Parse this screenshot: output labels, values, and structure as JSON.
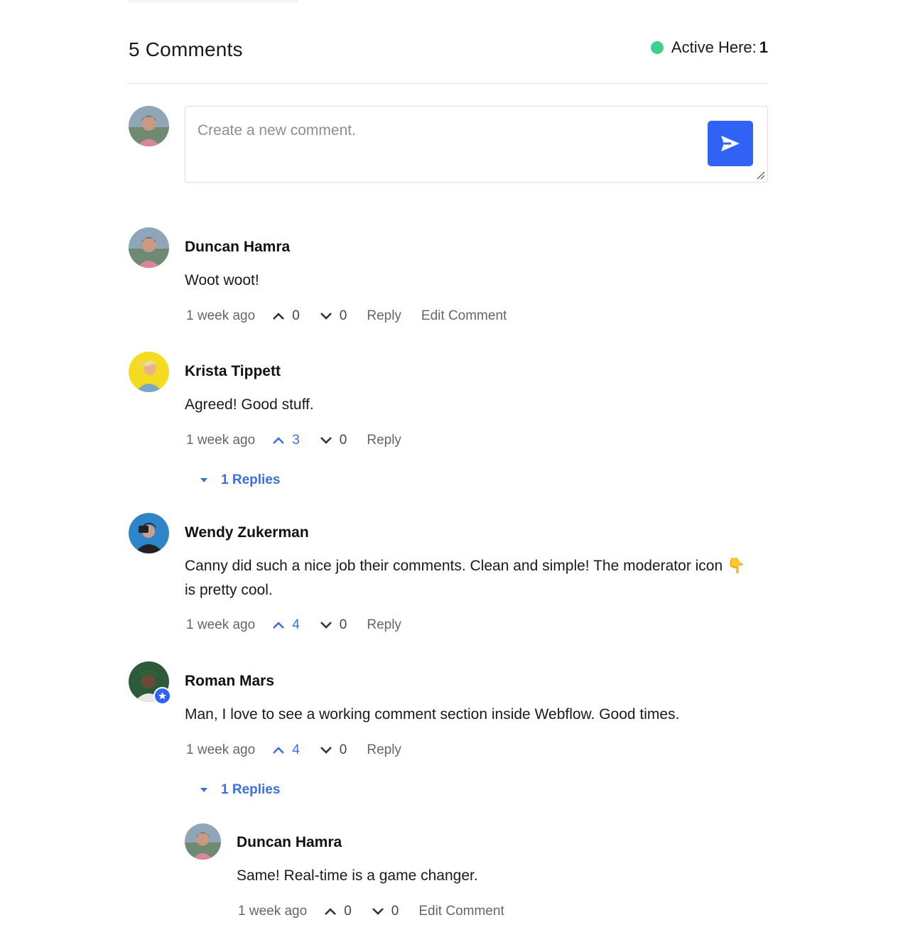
{
  "header": {
    "comment_count_label": "5 Comments",
    "active_label": "Active Here:",
    "active_count": "1",
    "active_color": "#3fcf8e"
  },
  "composer": {
    "placeholder": "Create a new comment.",
    "send_icon": "send-arrow-icon",
    "accent": "#2f62f5"
  },
  "comments": [
    {
      "author": "Duncan Hamra",
      "body": "Woot woot!",
      "time": "1 week ago",
      "upvotes": "0",
      "downvotes": "0",
      "reply_label": "Reply",
      "edit_label": "Edit Comment"
    },
    {
      "author": "Krista Tippett",
      "body": "Agreed! Good stuff.",
      "time": "1 week ago",
      "upvotes": "3",
      "downvotes": "0",
      "reply_label": "Reply",
      "replies_label": "1 Replies"
    },
    {
      "author": "Wendy Zukerman",
      "body_line1": "Canny did such a nice job their comments. Clean and simple! The moderator icon 👇",
      "body_line2": "is pretty cool.",
      "time": "1 week ago",
      "upvotes": "4",
      "downvotes": "0",
      "reply_label": "Reply"
    },
    {
      "author": "Roman Mars",
      "body": "Man, I love to see a working comment section inside Webflow. Good times.",
      "time": "1 week ago",
      "upvotes": "4",
      "downvotes": "0",
      "reply_label": "Reply",
      "replies_label": "1 Replies",
      "moderator_icon": "star-badge-icon",
      "replies": [
        {
          "author": "Duncan Hamra",
          "body": "Same! Real-time is a game changer.",
          "time": "1 week ago",
          "upvotes": "0",
          "downvotes": "0",
          "edit_label": "Edit Comment"
        }
      ]
    }
  ],
  "colors": {
    "link_blue": "#3c6fe0",
    "muted_text": "#666666",
    "divider": "#e3e5e8"
  }
}
